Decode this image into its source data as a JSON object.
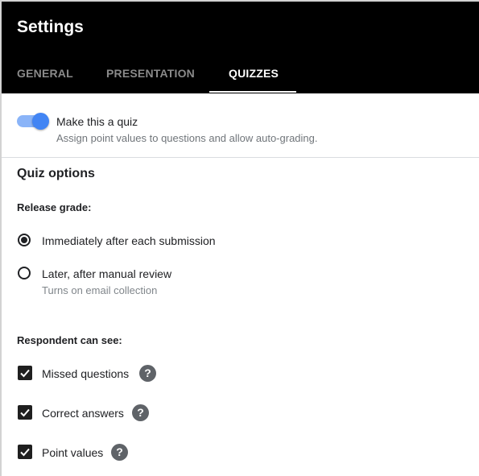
{
  "header": {
    "title": "Settings",
    "tabs": [
      "GENERAL",
      "PRESENTATION",
      "QUIZZES"
    ],
    "active_tab": "QUIZZES"
  },
  "quiz_toggle": {
    "label": "Make this a quiz",
    "description": "Assign point values to questions and allow auto-grading.",
    "on": true
  },
  "quiz_options": {
    "title": "Quiz options",
    "release_grade": {
      "title": "Release grade:",
      "options": [
        {
          "label": "Immediately after each submission",
          "description": "",
          "selected": true
        },
        {
          "label": "Later, after manual review",
          "description": "Turns on email collection",
          "selected": false
        }
      ]
    },
    "respondent_can_see": {
      "title": "Respondent can see:",
      "items": [
        {
          "label": "Missed questions",
          "checked": true
        },
        {
          "label": "Correct answers",
          "checked": true
        },
        {
          "label": "Point values",
          "checked": true
        }
      ]
    }
  },
  "help_glyph": "?",
  "colors": {
    "accent": "#4285f4",
    "accent_light": "#8ab4f8",
    "header_bg": "#000000"
  }
}
